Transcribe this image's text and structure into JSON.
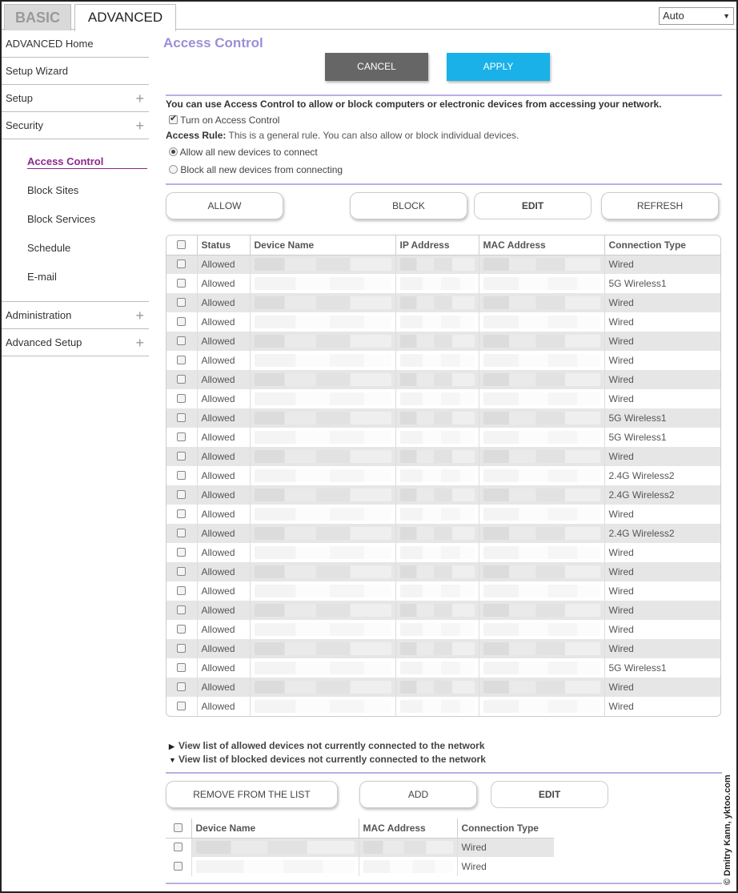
{
  "tabs": {
    "basic": "BASIC",
    "advanced": "ADVANCED"
  },
  "language_select": {
    "value": "Auto"
  },
  "sidebar": {
    "items": [
      {
        "label": "ADVANCED Home",
        "expandable": false
      },
      {
        "label": "Setup Wizard",
        "expandable": false
      },
      {
        "label": "Setup",
        "expandable": true
      },
      {
        "label": "Security",
        "expandable": true
      }
    ],
    "security_sub": [
      "Access Control",
      "Block Sites",
      "Block Services",
      "Schedule",
      "E-mail"
    ],
    "items_after": [
      {
        "label": "Administration",
        "expandable": true
      },
      {
        "label": "Advanced Setup",
        "expandable": true
      }
    ],
    "plus_glyph": "+"
  },
  "main": {
    "title": "Access Control",
    "cancel_label": "CANCEL",
    "apply_label": "APPLY",
    "intro": "You can use Access Control to allow or block computers or electronic devices from accessing your network.",
    "turn_on_label": "Turn on Access Control",
    "turn_on_checked": true,
    "access_rule_label": "Access Rule:",
    "access_rule_text": " This is a general rule. You can also allow or block individual devices.",
    "radio_allow": "Allow all new devices to connect",
    "radio_block": "Block all new devices from connecting",
    "allow_label": "ALLOW",
    "block_label": "BLOCK",
    "edit_label": "EDIT",
    "refresh_label": "REFRESH"
  },
  "devices_table": {
    "headers": [
      "Status",
      "Device Name",
      "IP Address",
      "MAC Address",
      "Connection Type"
    ],
    "rows": [
      {
        "status": "Allowed",
        "connection": "Wired"
      },
      {
        "status": "Allowed",
        "connection": "5G Wireless1"
      },
      {
        "status": "Allowed",
        "connection": "Wired"
      },
      {
        "status": "Allowed",
        "connection": "Wired"
      },
      {
        "status": "Allowed",
        "connection": "Wired"
      },
      {
        "status": "Allowed",
        "connection": "Wired"
      },
      {
        "status": "Allowed",
        "connection": "Wired"
      },
      {
        "status": "Allowed",
        "connection": "Wired"
      },
      {
        "status": "Allowed",
        "connection": "5G Wireless1"
      },
      {
        "status": "Allowed",
        "connection": "5G Wireless1"
      },
      {
        "status": "Allowed",
        "connection": "Wired"
      },
      {
        "status": "Allowed",
        "connection": "2.4G Wireless2"
      },
      {
        "status": "Allowed",
        "connection": "2.4G Wireless2"
      },
      {
        "status": "Allowed",
        "connection": "Wired"
      },
      {
        "status": "Allowed",
        "connection": "2.4G Wireless2"
      },
      {
        "status": "Allowed",
        "connection": "Wired"
      },
      {
        "status": "Allowed",
        "connection": "Wired"
      },
      {
        "status": "Allowed",
        "connection": "Wired"
      },
      {
        "status": "Allowed",
        "connection": "Wired"
      },
      {
        "status": "Allowed",
        "connection": "Wired"
      },
      {
        "status": "Allowed",
        "connection": "Wired"
      },
      {
        "status": "Allowed",
        "connection": "5G Wireless1"
      },
      {
        "status": "Allowed",
        "connection": "Wired"
      },
      {
        "status": "Allowed",
        "connection": "Wired"
      }
    ]
  },
  "toggles": {
    "allowed_list": "View list of allowed devices not currently connected to the network",
    "blocked_list": "View list of blocked devices not currently connected to the network",
    "collapsed_glyph": "▶",
    "expanded_glyph": "▼"
  },
  "blocked_section": {
    "remove_label": "REMOVE FROM THE LIST",
    "add_label": "ADD",
    "edit_label": "EDIT",
    "headers": [
      "Device Name",
      "MAC Address",
      "Connection Type"
    ],
    "rows": [
      {
        "connection": "Wired"
      },
      {
        "connection": "Wired"
      }
    ]
  },
  "watermark": "© Dmitry Kann, yktoo.com"
}
